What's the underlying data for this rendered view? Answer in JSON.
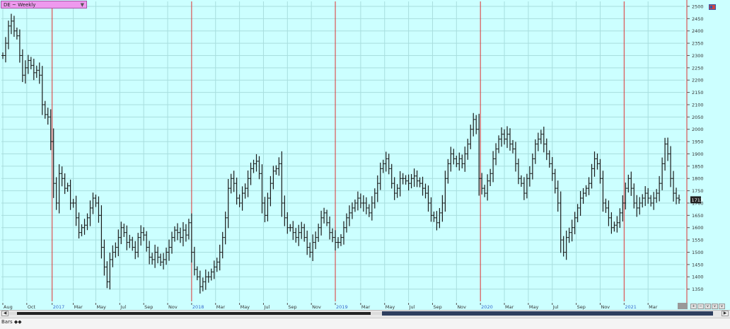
{
  "window": {
    "symbol_label": "DE ~ Weekly",
    "chart_style_tab": "Bars"
  },
  "colors": {
    "background": "#ccffff",
    "grid": "#a8dede",
    "bar": "#1a1a1a",
    "year_tick": "#3366cc",
    "month_tick": "#333333",
    "axis_line": "#dd3333",
    "last_price_bg": "#222222"
  },
  "chart_data": {
    "type": "bar",
    "subtype": "ohlc",
    "title": "DE ~ Weekly",
    "ylim": [
      1300,
      2520
    ],
    "y_ticks": [
      1350,
      1400,
      1450,
      1500,
      1550,
      1600,
      1650,
      1700,
      1750,
      1800,
      1850,
      1900,
      1950,
      2000,
      2050,
      2100,
      2150,
      2200,
      2250,
      2300,
      2350,
      2400,
      2450,
      2500
    ],
    "y_axis_side": "right",
    "grid": true,
    "last_price": "1713",
    "x_labels": [
      {
        "label": "Aug",
        "index": 0,
        "year": false
      },
      {
        "label": "Oct",
        "index": 8.5,
        "year": false
      },
      {
        "label": "2017",
        "index": 17.5,
        "year": true
      },
      {
        "label": "Mar",
        "index": 25,
        "year": false
      },
      {
        "label": "May",
        "index": 33,
        "year": false
      },
      {
        "label": "Jul",
        "index": 41.5,
        "year": false
      },
      {
        "label": "Sep",
        "index": 50,
        "year": false
      },
      {
        "label": "Nov",
        "index": 58.5,
        "year": false
      },
      {
        "label": "2018",
        "index": 67,
        "year": true
      },
      {
        "label": "Mar",
        "index": 75.5,
        "year": false
      },
      {
        "label": "May",
        "index": 84,
        "year": false
      },
      {
        "label": "Jul",
        "index": 92.5,
        "year": false
      },
      {
        "label": "Sep",
        "index": 101,
        "year": false
      },
      {
        "label": "Nov",
        "index": 109.5,
        "year": false
      },
      {
        "label": "2019",
        "index": 118,
        "year": true
      },
      {
        "label": "Mar",
        "index": 127,
        "year": false
      },
      {
        "label": "May",
        "index": 135.5,
        "year": false
      },
      {
        "label": "Jul",
        "index": 144,
        "year": false
      },
      {
        "label": "Sep",
        "index": 152.5,
        "year": false
      },
      {
        "label": "Nov",
        "index": 161,
        "year": false
      },
      {
        "label": "2020",
        "index": 169.5,
        "year": true
      },
      {
        "label": "Mar",
        "index": 178,
        "year": false
      },
      {
        "label": "May",
        "index": 186.5,
        "year": false
      },
      {
        "label": "Jul",
        "index": 195,
        "year": false
      },
      {
        "label": "Sep",
        "index": 203.5,
        "year": false
      },
      {
        "label": "Nov",
        "index": 212,
        "year": false
      },
      {
        "label": "2021",
        "index": 220.5,
        "year": true
      },
      {
        "label": "Mar",
        "index": 229,
        "year": false
      }
    ],
    "closes": [
      2300,
      2350,
      2420,
      2440,
      2400,
      2380,
      2300,
      2220,
      2250,
      2280,
      2260,
      2230,
      2240,
      2220,
      2100,
      2060,
      2050,
      1950,
      1780,
      1700,
      1820,
      1800,
      1760,
      1770,
      1700,
      1700,
      1640,
      1580,
      1600,
      1610,
      1640,
      1680,
      1720,
      1700,
      1650,
      1520,
      1440,
      1380,
      1470,
      1500,
      1520,
      1560,
      1600,
      1580,
      1540,
      1550,
      1520,
      1500,
      1560,
      1580,
      1570,
      1520,
      1480,
      1470,
      1500,
      1480,
      1460,
      1470,
      1500,
      1520,
      1560,
      1590,
      1580,
      1560,
      1590,
      1570,
      1620,
      1500,
      1430,
      1400,
      1360,
      1380,
      1400,
      1400,
      1420,
      1440,
      1460,
      1500,
      1560,
      1640,
      1760,
      1800,
      1780,
      1720,
      1700,
      1740,
      1760,
      1800,
      1840,
      1860,
      1870,
      1820,
      1700,
      1650,
      1720,
      1780,
      1830,
      1840,
      1860,
      1700,
      1640,
      1600,
      1600,
      1580,
      1560,
      1580,
      1600,
      1560,
      1520,
      1500,
      1540,
      1560,
      1600,
      1640,
      1660,
      1620,
      1580,
      1560,
      1540,
      1540,
      1560,
      1600,
      1640,
      1660,
      1680,
      1700,
      1720,
      1700,
      1700,
      1680,
      1660,
      1700,
      1740,
      1780,
      1840,
      1860,
      1880,
      1840,
      1780,
      1740,
      1760,
      1800,
      1800,
      1790,
      1780,
      1800,
      1810,
      1790,
      1780,
      1760,
      1740,
      1700,
      1650,
      1640,
      1620,
      1660,
      1700,
      1800,
      1860,
      1900,
      1880,
      1860,
      1880,
      1860,
      1900,
      1940,
      2000,
      2040,
      2000,
      1800,
      1760,
      1740,
      1790,
      1820,
      1880,
      1920,
      1960,
      1980,
      1960,
      1980,
      1940,
      1920,
      1860,
      1800,
      1780,
      1740,
      1800,
      1820,
      1880,
      1940,
      1960,
      1980,
      1940,
      1900,
      1860,
      1820,
      1760,
      1700,
      1550,
      1500,
      1560,
      1580,
      1600,
      1640,
      1680,
      1720,
      1740,
      1760,
      1780,
      1840,
      1880,
      1860,
      1800,
      1700,
      1680,
      1640,
      1600,
      1610,
      1620,
      1660,
      1700,
      1760,
      1800,
      1760,
      1700,
      1680,
      1700,
      1720,
      1740,
      1720,
      1700,
      1720,
      1740,
      1780,
      1860,
      1940,
      1900,
      1800,
      1740,
      1720,
      1713
    ]
  }
}
